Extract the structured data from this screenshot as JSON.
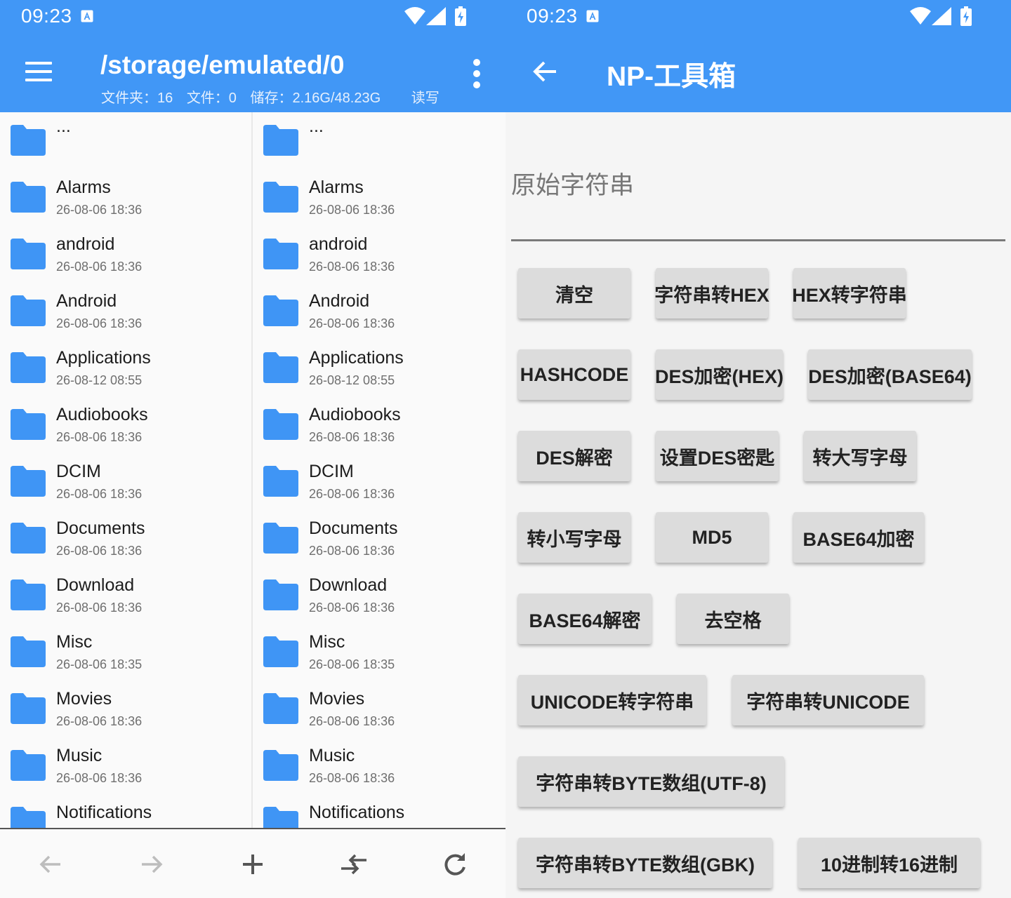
{
  "left": {
    "status": {
      "time": "09:23"
    },
    "appbar": {
      "path": "/storage/emulated/0",
      "folders": "文件夹：16",
      "files": "文件：0",
      "storage": "储存：2.16G/48.23G",
      "mode": "读写"
    },
    "pane1": [
      {
        "name": "...",
        "date": ""
      },
      {
        "name": "Alarms",
        "date": "26-08-06 18:36"
      },
      {
        "name": "android",
        "date": "26-08-06 18:36"
      },
      {
        "name": "Android",
        "date": "26-08-06 18:36"
      },
      {
        "name": "Applications",
        "date": "26-08-12 08:55"
      },
      {
        "name": "Audiobooks",
        "date": "26-08-06 18:36"
      },
      {
        "name": "DCIM",
        "date": "26-08-06 18:36"
      },
      {
        "name": "Documents",
        "date": "26-08-06 18:36"
      },
      {
        "name": "Download",
        "date": "26-08-06 18:36"
      },
      {
        "name": "Misc",
        "date": "26-08-06 18:35"
      },
      {
        "name": "Movies",
        "date": "26-08-06 18:36"
      },
      {
        "name": "Music",
        "date": "26-08-06 18:36"
      },
      {
        "name": "Notifications",
        "date": ""
      }
    ],
    "pane2": [
      {
        "name": "...",
        "date": ""
      },
      {
        "name": "Alarms",
        "date": "26-08-06 18:36"
      },
      {
        "name": "android",
        "date": "26-08-06 18:36"
      },
      {
        "name": "Android",
        "date": "26-08-06 18:36"
      },
      {
        "name": "Applications",
        "date": "26-08-12 08:55"
      },
      {
        "name": "Audiobooks",
        "date": "26-08-06 18:36"
      },
      {
        "name": "DCIM",
        "date": "26-08-06 18:36"
      },
      {
        "name": "Documents",
        "date": "26-08-06 18:36"
      },
      {
        "name": "Download",
        "date": "26-08-06 18:36"
      },
      {
        "name": "Misc",
        "date": "26-08-06 18:35"
      },
      {
        "name": "Movies",
        "date": "26-08-06 18:36"
      },
      {
        "name": "Music",
        "date": "26-08-06 18:36"
      },
      {
        "name": "Notifications",
        "date": ""
      }
    ],
    "bottombar": [
      "back-arrow-icon",
      "forward-arrow-icon",
      "plus-icon",
      "swap-icon",
      "refresh-icon"
    ]
  },
  "right": {
    "status": {
      "time": "09:23"
    },
    "appbar": {
      "title": "NP-工具箱"
    },
    "input": {
      "label": "原始字符串",
      "value": ""
    },
    "buttons": [
      {
        "label": "清空"
      },
      {
        "label": "字符串转HEX"
      },
      {
        "label": "HEX转字符串"
      },
      {
        "label": "HASHCODE"
      },
      {
        "label": "DES加密(HEX)"
      },
      {
        "label": "DES加密(BASE64)"
      },
      {
        "label": "DES解密"
      },
      {
        "label": "设置DES密匙"
      },
      {
        "label": "转大写字母"
      },
      {
        "label": "转小写字母"
      },
      {
        "label": "MD5"
      },
      {
        "label": "BASE64加密"
      },
      {
        "label": "BASE64解密"
      },
      {
        "label": "去空格"
      },
      {
        "label": "UNICODE转字符串"
      },
      {
        "label": "字符串转UNICODE"
      },
      {
        "label": "字符串转BYTE数组(UTF-8)"
      },
      {
        "label": "字符串转BYTE数组(GBK)"
      },
      {
        "label": "10进制转16进制"
      }
    ]
  },
  "colors": {
    "primary": "#4197f6",
    "folder": "#3f95f5",
    "button": "#dcdcdc"
  }
}
